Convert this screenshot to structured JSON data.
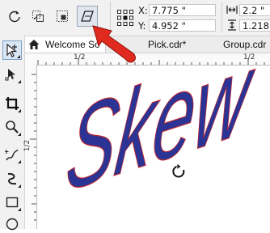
{
  "toolbar": {
    "x_label": "X:",
    "x_value": "7.775 \"",
    "y_label": "Y:",
    "y_value": "4.952 \"",
    "width_value": "2.2 \"",
    "height_value": "1.218"
  },
  "tabs": [
    {
      "label": "Welcome Sc"
    },
    {
      "label": "Pick.cdr*"
    },
    {
      "label": "Group.cdr"
    }
  ],
  "ruler": {
    "h_labels": [
      "1/2",
      "1/2"
    ],
    "v_labels": [
      "1/2"
    ]
  },
  "canvas": {
    "art_text": "Skew",
    "art_color": "#2b3494"
  },
  "colors": {
    "callout_arrow": "#e02a1f",
    "accent": "#2b3494"
  }
}
